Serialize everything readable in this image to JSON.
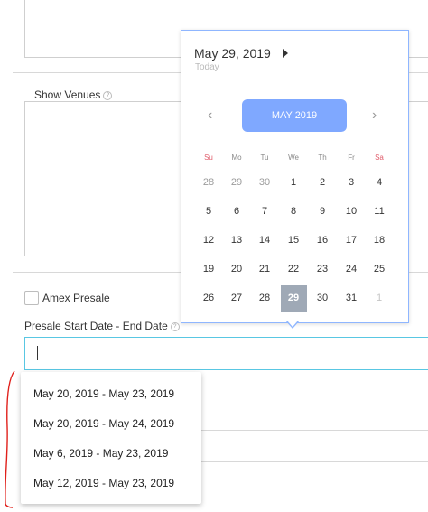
{
  "form": {
    "show_venues_label": "Show Venues",
    "amex_presale_label": "Amex Presale",
    "presale_range_label": "Presale Start Date - End Date",
    "presale_range_value": ""
  },
  "suggestions": [
    "May 20, 2019 - May 23, 2019",
    "May 20, 2019 - May 24, 2019",
    "May 6, 2019 - May 23, 2019",
    "May 12, 2019 - May 23, 2019"
  ],
  "calendar": {
    "selected_date": "May 29, 2019",
    "today_label": "Today",
    "month_label": "MAY 2019",
    "prev_icon": "chevron-left-icon",
    "next_icon": "chevron-right-icon",
    "weekdays": [
      "Su",
      "Mo",
      "Tu",
      "We",
      "Th",
      "Fr",
      "Sa"
    ],
    "weeks": [
      [
        "28",
        "29",
        "30",
        "1",
        "2",
        "3",
        "4"
      ],
      [
        "5",
        "6",
        "7",
        "8",
        "9",
        "10",
        "11"
      ],
      [
        "12",
        "13",
        "14",
        "15",
        "16",
        "17",
        "18"
      ],
      [
        "19",
        "20",
        "21",
        "22",
        "23",
        "24",
        "25"
      ],
      [
        "26",
        "27",
        "28",
        "29",
        "30",
        "31",
        "1"
      ]
    ],
    "selected_day": "29",
    "accent_color": "#7fa8ff",
    "border_color": "#8fb6ff",
    "weekend_color": "#e05b6a",
    "input_focus_color": "#59c7e3"
  },
  "annotation": {
    "color": "#e0201b",
    "shape": "red bracket"
  }
}
